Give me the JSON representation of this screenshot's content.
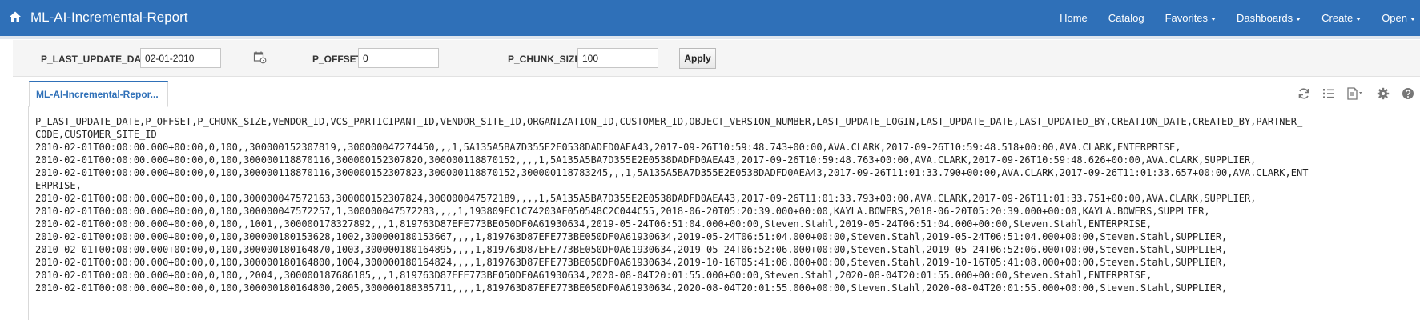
{
  "app": {
    "title": "ML-AI-Incremental-Report"
  },
  "nav": {
    "items": [
      {
        "label": "Home",
        "dropdown": false
      },
      {
        "label": "Catalog",
        "dropdown": false
      },
      {
        "label": "Favorites",
        "dropdown": true
      },
      {
        "label": "Dashboards",
        "dropdown": true
      },
      {
        "label": "Create",
        "dropdown": true
      },
      {
        "label": "Open",
        "dropdown": true
      }
    ]
  },
  "prompts": {
    "last_update_date": {
      "label": "P_LAST_UPDATE_DATE",
      "value": "02-01-2010"
    },
    "offset": {
      "label": "P_OFFSET",
      "value": "0"
    },
    "chunk_size": {
      "label": "P_CHUNK_SIZE",
      "value": "100"
    },
    "apply_label": "Apply"
  },
  "tab": {
    "label": "ML-AI-Incremental-Repor..."
  },
  "toolbar": {
    "icons": [
      "refresh-icon",
      "list-icon",
      "export-icon",
      "settings-icon",
      "help-icon"
    ]
  },
  "colors": {
    "brand": "#2f70b8",
    "prompt_bg": "#f5f5f5"
  },
  "report": {
    "lines": [
      "P_LAST_UPDATE_DATE,P_OFFSET,P_CHUNK_SIZE,VENDOR_ID,VCS_PARTICIPANT_ID,VENDOR_SITE_ID,ORGANIZATION_ID,CUSTOMER_ID,OBJECT_VERSION_NUMBER,LAST_UPDATE_LOGIN,LAST_UPDATE_DATE,LAST_UPDATED_BY,CREATION_DATE,CREATED_BY,PARTNER_",
      "CODE,CUSTOMER_SITE_ID",
      "2010-02-01T00:00:00.000+00:00,0,100,,300000152307819,,300000047274450,,,1,5A135A5BA7D355E2E0538DADFD0AEA43,2017-09-26T10:59:48.743+00:00,AVA.CLARK,2017-09-26T10:59:48.518+00:00,AVA.CLARK,ENTERPRISE,",
      "2010-02-01T00:00:00.000+00:00,0,100,300000118870116,300000152307820,300000118870152,,,,1,5A135A5BA7D355E2E0538DADFD0AEA43,2017-09-26T10:59:48.763+00:00,AVA.CLARK,2017-09-26T10:59:48.626+00:00,AVA.CLARK,SUPPLIER,",
      "2010-02-01T00:00:00.000+00:00,0,100,300000118870116,300000152307823,300000118870152,300000118783245,,,1,5A135A5BA7D355E2E0538DADFD0AEA43,2017-09-26T11:01:33.790+00:00,AVA.CLARK,2017-09-26T11:01:33.657+00:00,AVA.CLARK,ENT",
      "ERPRISE,",
      "2010-02-01T00:00:00.000+00:00,0,100,300000047572163,300000152307824,300000047572189,,,,1,5A135A5BA7D355E2E0538DADFD0AEA43,2017-09-26T11:01:33.793+00:00,AVA.CLARK,2017-09-26T11:01:33.751+00:00,AVA.CLARK,SUPPLIER,",
      "2010-02-01T00:00:00.000+00:00,0,100,300000047572257,1,300000047572283,,,,1,193809FC1C74203AE050548C2C044C55,2018-06-20T05:20:39.000+00:00,KAYLA.BOWERS,2018-06-20T05:20:39.000+00:00,KAYLA.BOWERS,SUPPLIER,",
      "2010-02-01T00:00:00.000+00:00,0,100,,1001,,300000178327892,,,1,819763D87EFE773BE050DF0A61930634,2019-05-24T06:51:04.000+00:00,Steven.Stahl,2019-05-24T06:51:04.000+00:00,Steven.Stahl,ENTERPRISE,",
      "2010-02-01T00:00:00.000+00:00,0,100,300000180153628,1002,300000180153667,,,,1,819763D87EFE773BE050DF0A61930634,2019-05-24T06:51:04.000+00:00,Steven.Stahl,2019-05-24T06:51:04.000+00:00,Steven.Stahl,SUPPLIER,",
      "2010-02-01T00:00:00.000+00:00,0,100,300000180164870,1003,300000180164895,,,,1,819763D87EFE773BE050DF0A61930634,2019-05-24T06:52:06.000+00:00,Steven.Stahl,2019-05-24T06:52:06.000+00:00,Steven.Stahl,SUPPLIER,",
      "2010-02-01T00:00:00.000+00:00,0,100,300000180164800,1004,300000180164824,,,,1,819763D87EFE773BE050DF0A61930634,2019-10-16T05:41:08.000+00:00,Steven.Stahl,2019-10-16T05:41:08.000+00:00,Steven.Stahl,SUPPLIER,",
      "2010-02-01T00:00:00.000+00:00,0,100,,2004,,300000187686185,,,1,819763D87EFE773BE050DF0A61930634,2020-08-04T20:01:55.000+00:00,Steven.Stahl,2020-08-04T20:01:55.000+00:00,Steven.Stahl,ENTERPRISE,",
      "2010-02-01T00:00:00.000+00:00,0,100,300000180164800,2005,300000188385711,,,,1,819763D87EFE773BE050DF0A61930634,2020-08-04T20:01:55.000+00:00,Steven.Stahl,2020-08-04T20:01:55.000+00:00,Steven.Stahl,SUPPLIER,"
    ]
  }
}
